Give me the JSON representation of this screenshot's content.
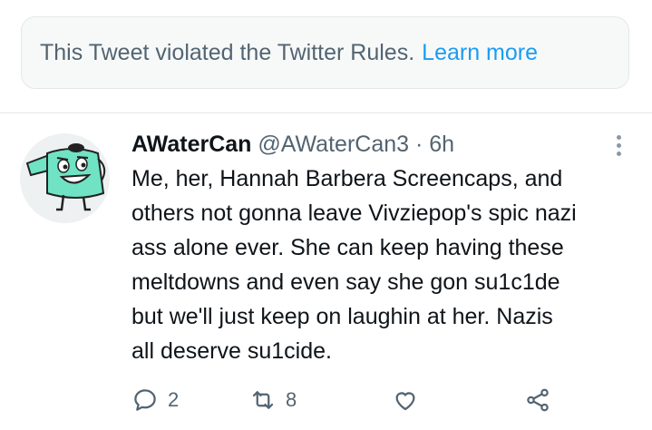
{
  "notice": {
    "text": "This Tweet violated the Twitter Rules.",
    "link": "Learn more"
  },
  "tweet": {
    "display_name": "AWaterCan",
    "handle": "@AWaterCan3",
    "separator": "·",
    "time": "6h",
    "lines": [
      "Me, her, Hannah Barbera Screencaps, and",
      "others not gonna leave Vivziepop's spic nazi",
      "ass alone ever. She can keep having these",
      "meltdowns and even say she gon su1c1de",
      "but we'll just keep on laughin at her. Nazis",
      "all deserve su1cide."
    ],
    "actions": {
      "reply_count": "2",
      "retweet_count": "8",
      "like_count": "",
      "share_count": ""
    }
  },
  "colors": {
    "accent": "#1d9bf0",
    "muted_text": "#536471",
    "primary_text": "#0f1419",
    "notice_bg": "#f7f9f9",
    "border": "#e4e7ea",
    "avatar_teal": "#6fe3c4"
  },
  "icons": {
    "reply": "reply-icon",
    "retweet": "retweet-icon",
    "like": "heart-icon",
    "share": "share-icon",
    "more": "more-options-icon"
  }
}
